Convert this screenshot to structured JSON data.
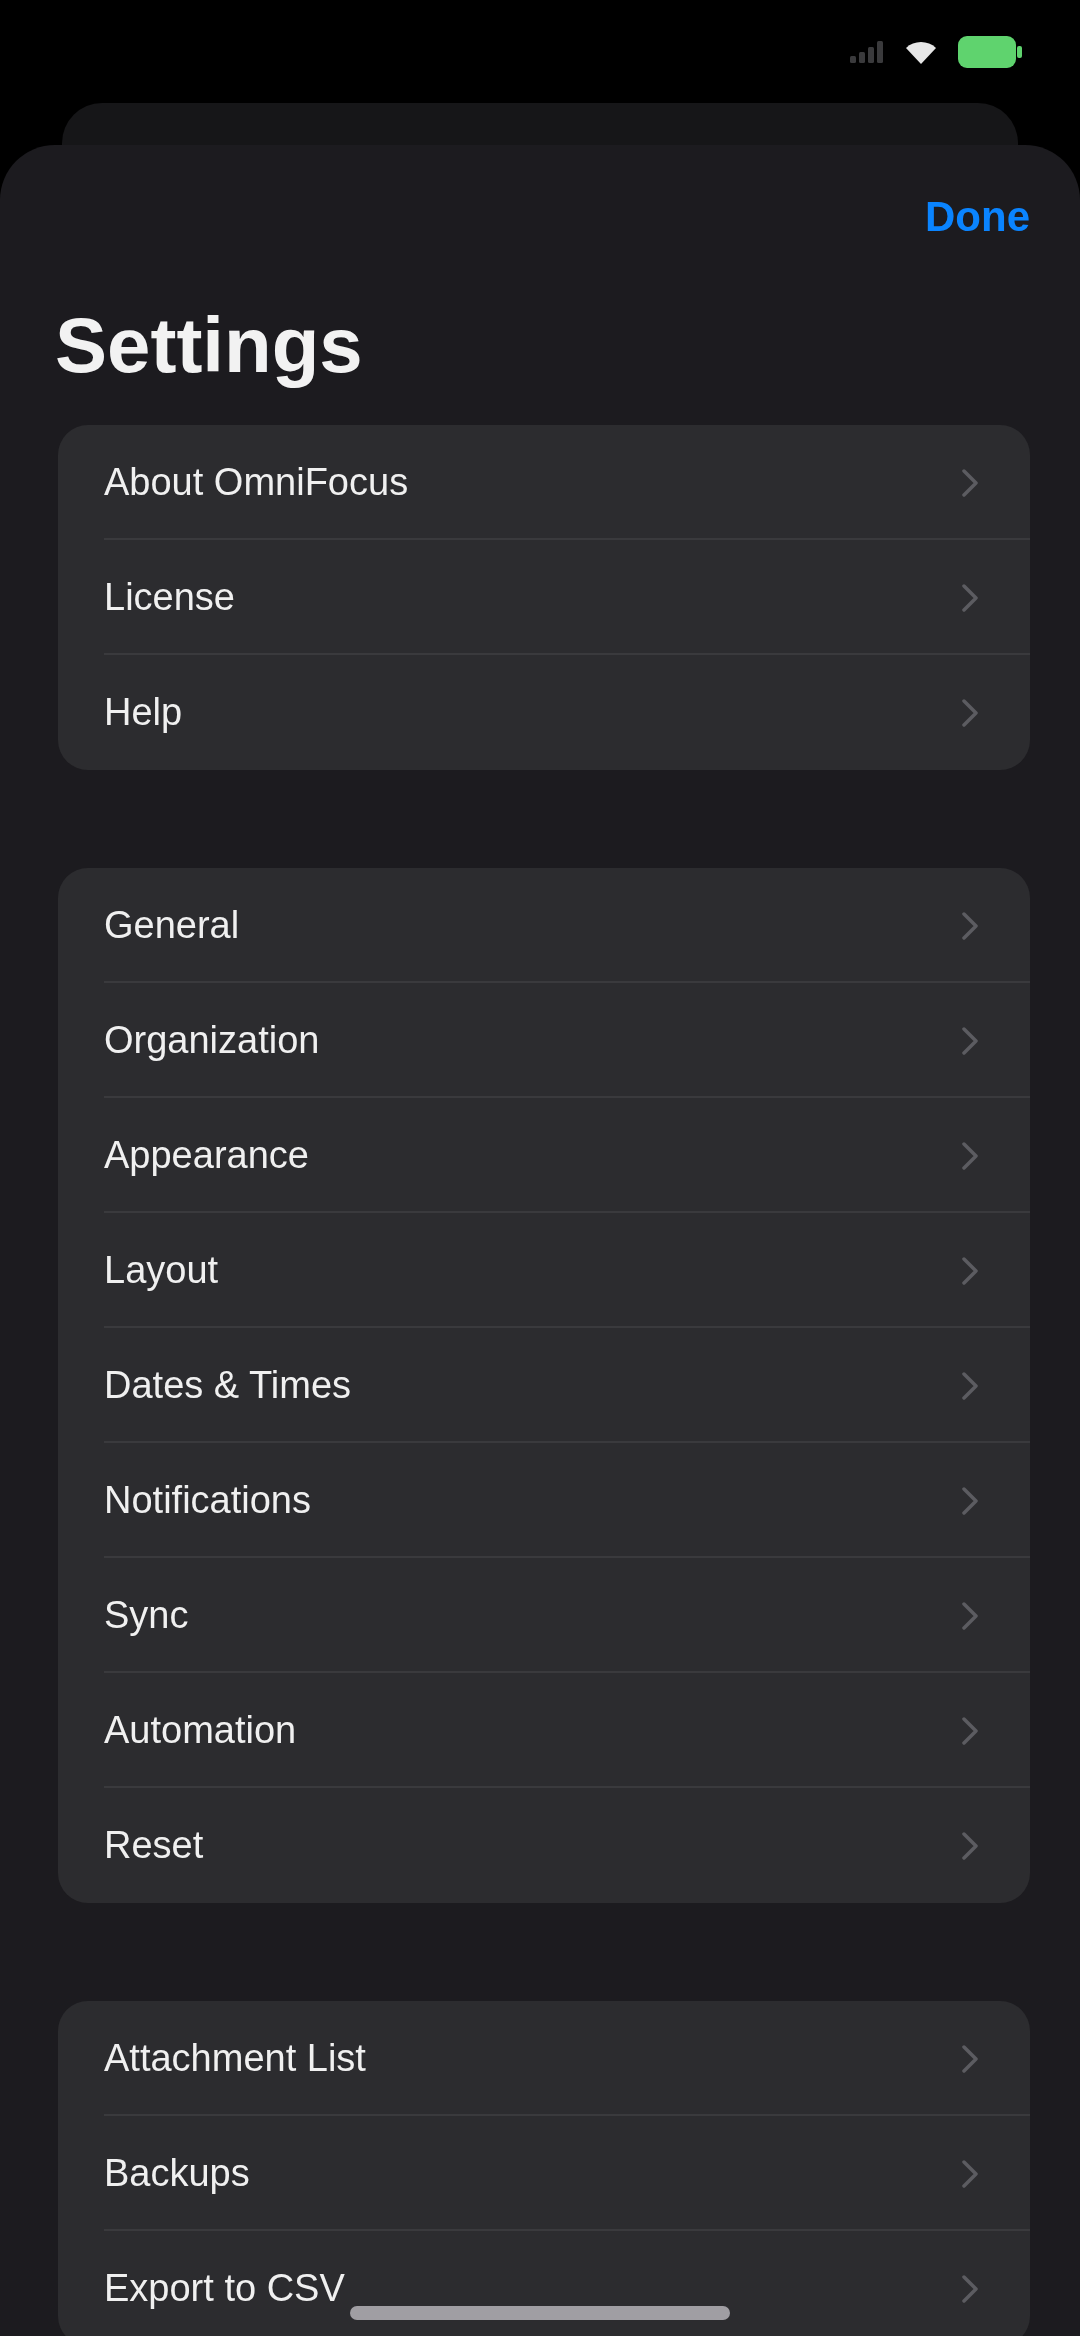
{
  "nav": {
    "done_button": "Done"
  },
  "title": "Settings",
  "groups": [
    {
      "items": [
        {
          "label": "About OmniFocus"
        },
        {
          "label": "License"
        },
        {
          "label": "Help"
        }
      ]
    },
    {
      "items": [
        {
          "label": "General"
        },
        {
          "label": "Organization"
        },
        {
          "label": "Appearance"
        },
        {
          "label": "Layout"
        },
        {
          "label": "Dates & Times"
        },
        {
          "label": "Notifications"
        },
        {
          "label": "Sync"
        },
        {
          "label": "Automation"
        },
        {
          "label": "Reset"
        }
      ]
    },
    {
      "items": [
        {
          "label": "Attachment List"
        },
        {
          "label": "Backups"
        },
        {
          "label": "Export to CSV"
        }
      ]
    }
  ]
}
